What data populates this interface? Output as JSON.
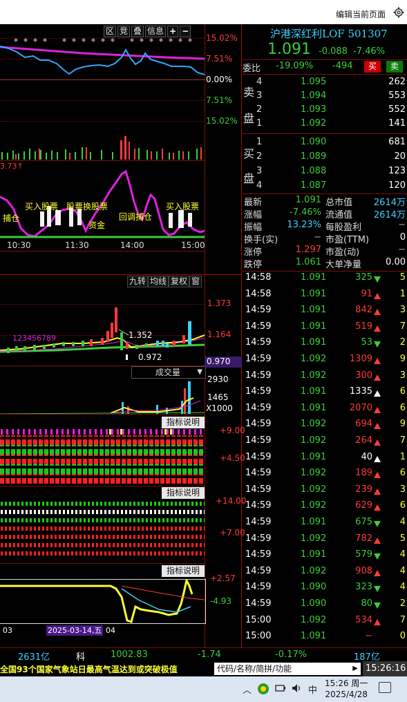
{
  "window": {
    "edit_page_label": "编辑当前页面"
  },
  "intraday": {
    "toolbar": [
      "区",
      "竞",
      "叠",
      "信息",
      "+",
      "−"
    ],
    "scale_right": [
      "15.02%",
      "7.51%",
      "0.00%",
      "7.51%",
      "15.02%"
    ],
    "vol_marker": "3.73↑",
    "times": [
      "10:30",
      "11:30",
      "14:00",
      "15:00"
    ],
    "annotations": [
      "买入股票",
      "股票换股票",
      "买入股票",
      "捕仓",
      "资金",
      "回调捕仓"
    ]
  },
  "kline": {
    "toolbar": [
      "九转",
      "均线",
      "复权",
      "窗"
    ],
    "price_high_label": "1.352",
    "price_low_label": "0.972",
    "scale_right": [
      "1.373",
      "1.164"
    ],
    "current_price": "0.970",
    "nine_turn": "123456789",
    "volume_selector": "成交量",
    "volume_scale": [
      "2930",
      "1465",
      "X1000"
    ],
    "indicator1": {
      "button": "指标说明",
      "scale": [
        "+9.00",
        "+4.50"
      ]
    },
    "indicator2": {
      "button": "指标说明",
      "scale": [
        "+14.00",
        "+7.00"
      ]
    },
    "indicator3": {
      "button": "指标说明",
      "scale": [
        "+2.57",
        "-4.93"
      ]
    },
    "dates": [
      "03",
      "2025-03-14,五",
      "04"
    ]
  },
  "quote": {
    "name": "沪港深红利LOF 501307",
    "price": "1.091",
    "change": "-0.088",
    "change_pct": "-7.46%",
    "weibi_label": "委比",
    "weibi_pct": "-19.09%",
    "weibi_diff": "-494",
    "buy_btn": "买",
    "sell_btn": "卖",
    "sell_label": [
      "卖",
      "盘"
    ],
    "buy_label": [
      "买",
      "盘"
    ],
    "asks": [
      {
        "lvl": "4",
        "price": "1.095",
        "vol": "262"
      },
      {
        "lvl": "3",
        "price": "1.094",
        "vol": "553"
      },
      {
        "lvl": "2",
        "price": "1.093",
        "vol": "552"
      },
      {
        "lvl": "1",
        "price": "1.092",
        "vol": "141"
      }
    ],
    "bids": [
      {
        "lvl": "1",
        "price": "1.090",
        "vol": "681"
      },
      {
        "lvl": "2",
        "price": "1.089",
        "vol": "20"
      },
      {
        "lvl": "3",
        "price": "1.088",
        "vol": "123"
      },
      {
        "lvl": "4",
        "price": "1.087",
        "vol": "120"
      }
    ],
    "stats": [
      {
        "l1": "最新",
        "v1": "1.091",
        "c1": "green",
        "l2": "总市值",
        "v2": "2614万",
        "c2": "cyan"
      },
      {
        "l1": "涨幅",
        "v1": "-7.46%",
        "c1": "green",
        "l2": "流通值",
        "v2": "2614万",
        "c2": "cyan"
      },
      {
        "l1": "振幅",
        "v1": "13.23%",
        "c1": "cyan",
        "l2": "每股盈利",
        "v2": "−",
        "c2": "grey"
      },
      {
        "l1": "换手(实)",
        "v1": "−",
        "c1": "grey",
        "l2": "市盈(TTM)",
        "v2": "0",
        "c2": "white"
      },
      {
        "l1": "涨停",
        "v1": "1.297",
        "c1": "red",
        "l2": "市盈(动)",
        "v2": "−",
        "c2": "grey"
      },
      {
        "l1": "跌停",
        "v1": "1.061",
        "c1": "green",
        "l2": "大单净量",
        "v2": "0.00",
        "c2": "white"
      }
    ],
    "ticks": [
      {
        "t": "14:58",
        "p": "1.091",
        "pc": "green",
        "v": "325",
        "vc": "green",
        "d": "down",
        "n": "5"
      },
      {
        "t": "14:58",
        "p": "1.091",
        "pc": "green",
        "v": "91",
        "vc": "red",
        "d": "up",
        "n": "1"
      },
      {
        "t": "14:59",
        "p": "1.091",
        "pc": "green",
        "v": "842",
        "vc": "red",
        "d": "up",
        "n": "3"
      },
      {
        "t": "14:59",
        "p": "1.091",
        "pc": "green",
        "v": "519",
        "vc": "red",
        "d": "up",
        "n": "7"
      },
      {
        "t": "14:59",
        "p": "1.091",
        "pc": "green",
        "v": "53",
        "vc": "green",
        "d": "down",
        "n": "2"
      },
      {
        "t": "14:59",
        "p": "1.092",
        "pc": "green",
        "v": "1309",
        "vc": "red",
        "d": "up",
        "n": "9"
      },
      {
        "t": "14:59",
        "p": "1.092",
        "pc": "green",
        "v": "300",
        "vc": "red",
        "d": "up",
        "n": "3"
      },
      {
        "t": "14:59",
        "p": "1.091",
        "pc": "green",
        "v": "1335",
        "vc": "white",
        "d": "upw",
        "n": "6"
      },
      {
        "t": "14:59",
        "p": "1.091",
        "pc": "green",
        "v": "2070",
        "vc": "red",
        "d": "up",
        "n": "6"
      },
      {
        "t": "14:59",
        "p": "1.092",
        "pc": "green",
        "v": "694",
        "vc": "red",
        "d": "up",
        "n": "9"
      },
      {
        "t": "14:59",
        "p": "1.092",
        "pc": "green",
        "v": "264",
        "vc": "red",
        "d": "up",
        "n": "7"
      },
      {
        "t": "14:59",
        "p": "1.091",
        "pc": "green",
        "v": "40",
        "vc": "white",
        "d": "upw",
        "n": "1"
      },
      {
        "t": "14:59",
        "p": "1.092",
        "pc": "green",
        "v": "189",
        "vc": "red",
        "d": "up",
        "n": "6"
      },
      {
        "t": "14:59",
        "p": "1.092",
        "pc": "green",
        "v": "239",
        "vc": "red",
        "d": "up",
        "n": "3"
      },
      {
        "t": "14:59",
        "p": "1.092",
        "pc": "green",
        "v": "629",
        "vc": "red",
        "d": "up",
        "n": "6"
      },
      {
        "t": "14:59",
        "p": "1.091",
        "pc": "green",
        "v": "675",
        "vc": "green",
        "d": "down",
        "n": "4"
      },
      {
        "t": "14:59",
        "p": "1.092",
        "pc": "green",
        "v": "782",
        "vc": "red",
        "d": "up",
        "n": "5"
      },
      {
        "t": "14:59",
        "p": "1.091",
        "pc": "green",
        "v": "579",
        "vc": "green",
        "d": "down",
        "n": "4"
      },
      {
        "t": "14:59",
        "p": "1.092",
        "pc": "green",
        "v": "908",
        "vc": "red",
        "d": "up",
        "n": "4"
      },
      {
        "t": "14:59",
        "p": "1.090",
        "pc": "green",
        "v": "323",
        "vc": "green",
        "d": "down",
        "n": "4"
      },
      {
        "t": "14:59",
        "p": "1.090",
        "pc": "green",
        "v": "80",
        "vc": "green",
        "d": "down",
        "n": "2"
      },
      {
        "t": "15:00",
        "p": "1.092",
        "pc": "green",
        "v": "534",
        "vc": "red",
        "d": "up",
        "n": "7"
      },
      {
        "t": "15:00",
        "p": "1.091",
        "pc": "green",
        "v": "−",
        "vc": "red",
        "d": "",
        "n": "0"
      }
    ]
  },
  "status": {
    "turnover": "2631亿",
    "ke_label": "科",
    "ke_index": "1002.83",
    "ke_change": "-1.74",
    "ke_pct": "-0.17%",
    "ke_amount": "187亿"
  },
  "news": {
    "headline": "全国93个国家气象站日最高气温达到或突破极值",
    "search_placeholder": "代码/名称/简拼/功能",
    "clock": "15:26:16"
  },
  "taskbar": {
    "ime": "中",
    "time": "15:26 周一",
    "date": "2025/4/28"
  }
}
